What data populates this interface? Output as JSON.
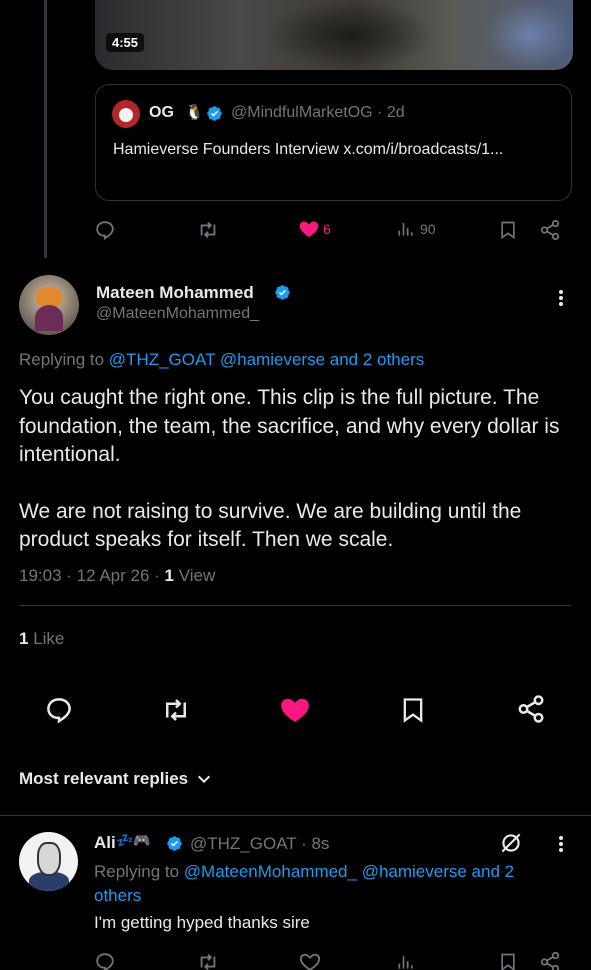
{
  "quoted_post": {
    "video_duration": "4:55",
    "author_name": "OG",
    "author_emoji": "🐧",
    "author_handle": "@MindfulMarketOG · 2d",
    "text": "Hamieverse Founders Interview x.com/i/broadcasts/1...",
    "actions": {
      "likes": "6",
      "views": "90"
    }
  },
  "main_post": {
    "author_name": "Mateen Mohammed",
    "author_handle": "@MateenMohammed_",
    "replying_prefix": "Replying to",
    "replying_to_1": "@THZ_GOAT",
    "replying_to_2": "@hamieverse",
    "replying_to_others": "and 2 others",
    "paragraph_1": "You caught the right one. This clip is the full picture. The foundation, the team, the sacrifice, and why every dollar is intentional.",
    "paragraph_2": "We are not raising to survive. We are building until the product speaks for itself. Then we scale.",
    "timestamp": "19:03 · 12 Apr 26 · ",
    "views_count": "1",
    "views_label": " View",
    "likes_count": "1",
    "likes_label": " Like"
  },
  "replies_sort": {
    "label": "Most relevant replies"
  },
  "reply": {
    "author_name": "Ali",
    "author_emoji": "💤🎮",
    "author_handle": "@THZ_GOAT · 8s",
    "replying_prefix": "Replying to",
    "replying_to_1": "@MateenMohammed_",
    "replying_to_2": "@hamieverse and 2 others",
    "text": "I'm getting hyped thanks sire"
  },
  "colors": {
    "background": "#000000",
    "text_primary": "#e7e9ea",
    "text_secondary": "#71767b",
    "link": "#1d9bf0",
    "like_active": "#f91880",
    "divider": "#2f3336"
  },
  "icons": [
    "reply-icon",
    "retweet-icon",
    "heart-icon",
    "views-icon",
    "bookmark-icon",
    "share-icon",
    "verified-icon",
    "more-icon",
    "chevron-down-icon",
    "grok-icon"
  ]
}
